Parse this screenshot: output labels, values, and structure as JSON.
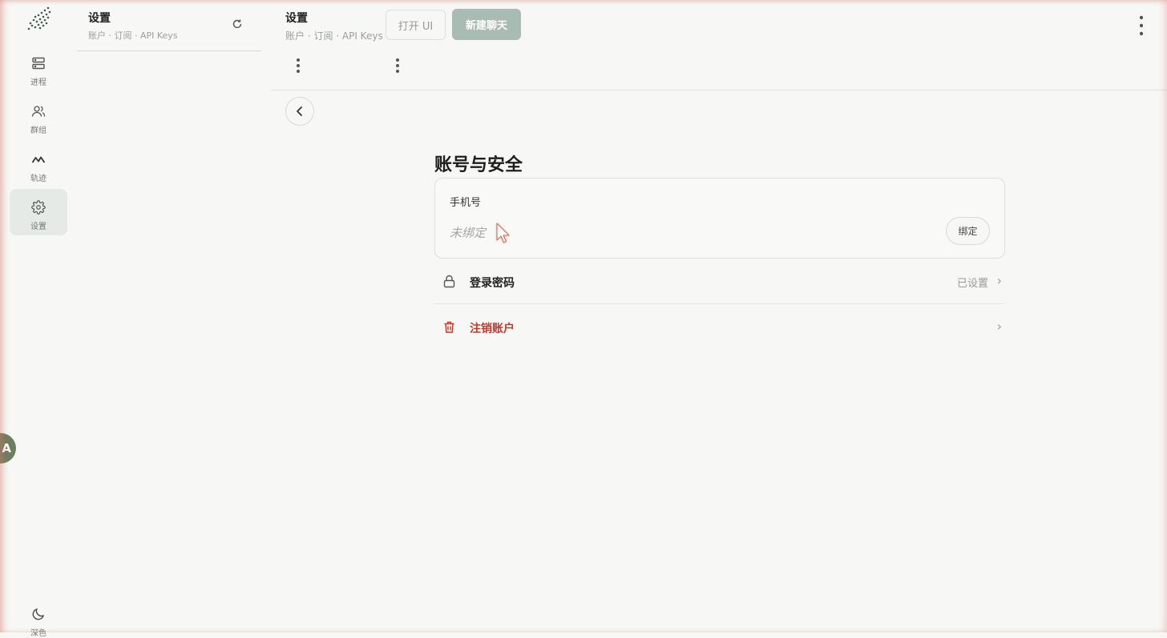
{
  "rail": {
    "items": [
      {
        "label": "进程",
        "icon": "server-icon"
      },
      {
        "label": "群组",
        "icon": "users-icon"
      },
      {
        "label": "轨迹",
        "icon": "activity-icon"
      },
      {
        "label": "设置",
        "icon": "gear-icon",
        "active": true
      }
    ],
    "bottom_label": "深色",
    "translate_label": "A"
  },
  "list": {
    "title": "设置",
    "subtitle": "账户 · 订阅 · API Keys"
  },
  "header": {
    "title": "设置",
    "subtitle": "账户 · 订阅 · API Keys",
    "open_ui_label": "打开 UI",
    "new_chat_label": "新建聊天"
  },
  "main": {
    "section_title": "账号与安全",
    "phone": {
      "label": "手机号",
      "value": "未绑定",
      "bind_label": "绑定"
    },
    "rows": [
      {
        "label": "登录密码",
        "status": "已设置",
        "icon": "lock-icon",
        "chevron": "›"
      },
      {
        "label": "注销账户",
        "status": "",
        "icon": "trash-icon",
        "chevron": "›"
      }
    ]
  },
  "colors": {
    "accent": "#a8bcb3",
    "danger": "#c0392b",
    "active_bg": "#e5eae6",
    "background": "#f7f8f6"
  }
}
